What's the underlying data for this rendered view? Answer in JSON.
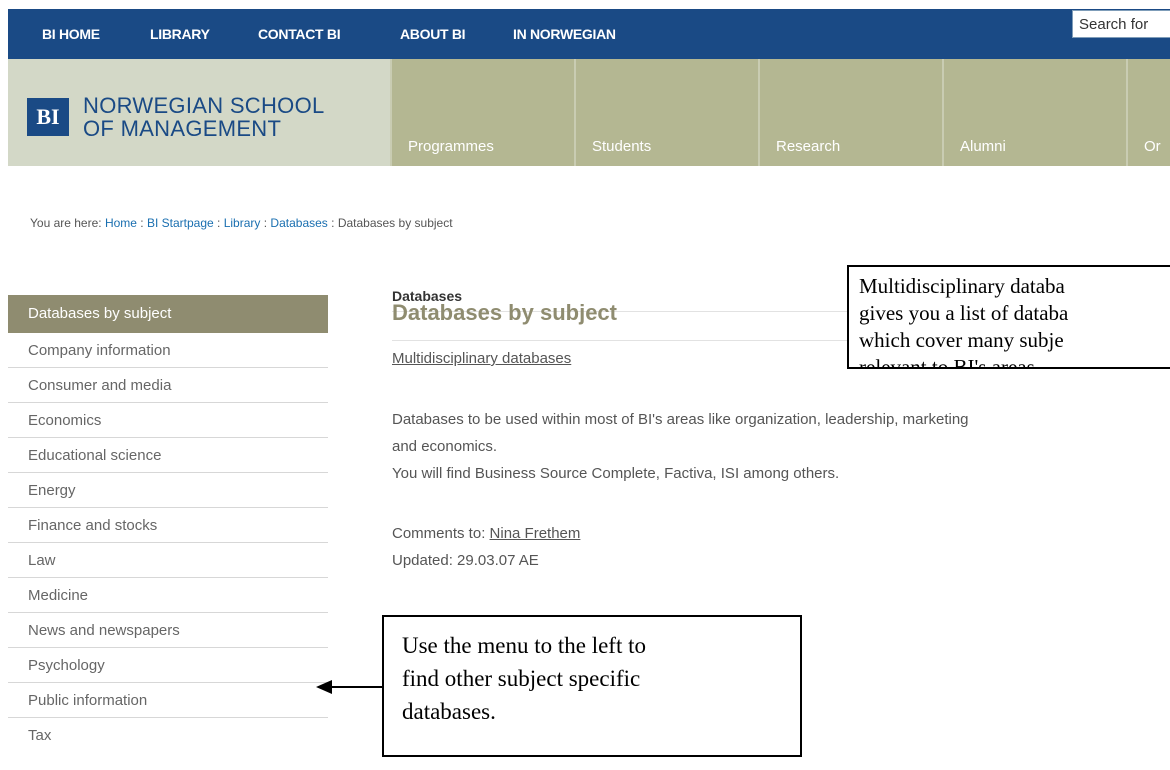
{
  "topnav": {
    "items": [
      "BI HOME",
      "LIBRARY",
      "CONTACT BI",
      "ABOUT BI",
      "IN NORWEGIAN"
    ],
    "search_placeholder": "Search for"
  },
  "logo": {
    "mark": "BI",
    "line1": "NORWEGIAN SCHOOL",
    "line2": "OF MANAGEMENT"
  },
  "mainnav": {
    "items": [
      "Programmes",
      "Students",
      "Research",
      "Alumni",
      "Or"
    ]
  },
  "breadcrumb": {
    "prefix": "You are here: ",
    "home": "Home",
    "sep": " : ",
    "startpage": "BI Startpage",
    "library": "Library",
    "databases": "Databases",
    "current": "Databases by subject"
  },
  "sidebar": {
    "header": "Databases by subject",
    "items": [
      "Company information",
      "Consumer and media",
      "Economics",
      "Educational science",
      "Energy",
      "Finance and stocks",
      "Law",
      "Medicine",
      "News and newspapers",
      "Psychology",
      "Public information",
      "Tax"
    ]
  },
  "main": {
    "section_label": "Databases",
    "title": "Databases by subject",
    "link": "Multidisciplinary databases",
    "desc_line1": "Databases to be used within most of BI's areas like organization, leadership, marketing",
    "desc_line2": "and economics.",
    "desc_line3": "You will find Business Source Complete, Factiva, ISI among others.",
    "comments_label": "Comments to: ",
    "comments_name": "Nina Frethem",
    "updated": "Updated: 29.03.07 AE"
  },
  "callouts": {
    "top_line1": "Multidisciplinary databa",
    "top_line2": "gives you a list of databa",
    "top_line3": "which cover many subje",
    "top_line4": "relevant to BI's areas.",
    "bottom_line1": "Use the menu to the left to",
    "bottom_line2": "find other subject specific",
    "bottom_line3": "databases."
  }
}
